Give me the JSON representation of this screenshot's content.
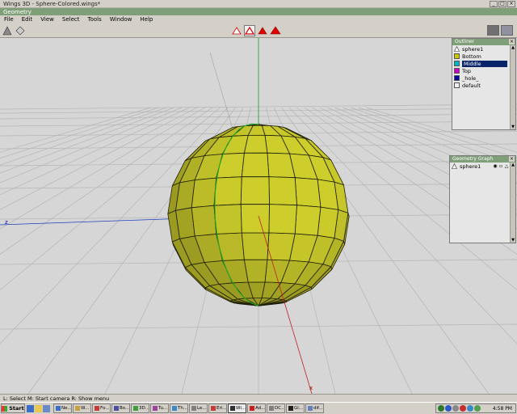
{
  "window": {
    "title": "Wings 3D - Sphere-Colored.wings*"
  },
  "geometry_bar": {
    "label": "Geometry"
  },
  "menu": [
    "File",
    "Edit",
    "View",
    "Select",
    "Tools",
    "Window",
    "Help"
  ],
  "outliner": {
    "title": "Outliner",
    "items": [
      {
        "label": "sphere1",
        "icon": "object-triangle-icon",
        "color": "#ffffff"
      },
      {
        "label": "Bottom",
        "icon": "material-icon",
        "color": "#c8c800"
      },
      {
        "label": "Middle",
        "icon": "material-icon",
        "color": "#00b4c8",
        "selected": true
      },
      {
        "label": "Top",
        "icon": "material-icon",
        "color": "#c800c8"
      },
      {
        "label": "_hole_",
        "icon": "material-icon",
        "color": "#0000a0"
      },
      {
        "label": "default",
        "icon": "material-icon",
        "color": "#f0f0f0"
      }
    ]
  },
  "geometry_graph": {
    "title": "Geometry Graph",
    "items": [
      {
        "label": "sphere1"
      }
    ]
  },
  "viewport": {
    "axis_x_label": "x",
    "axis_z_label": "z",
    "sphere_color": "#cdcd2c",
    "sphere_shade": "#8a8a1e"
  },
  "statusbar": {
    "text": "L: Select   M: Start camera   R: Show menu"
  },
  "taskbar": {
    "start_label": "Start",
    "tasks": [
      {
        "label": "Ne...",
        "color": "#3a6ec8"
      },
      {
        "label": "W...",
        "color": "#c8a040"
      },
      {
        "label": "Fo...",
        "color": "#c83a3a"
      },
      {
        "label": "Bo...",
        "color": "#5050a0"
      },
      {
        "label": "3D...",
        "color": "#40a040"
      },
      {
        "label": "Tu...",
        "color": "#a040a0"
      },
      {
        "label": "Th...",
        "color": "#3a8ac8"
      },
      {
        "label": "Le...",
        "color": "#808080"
      },
      {
        "label": "Eri...",
        "color": "#c83a3a"
      },
      {
        "label": "Wi...",
        "color": "#303030",
        "active": true
      },
      {
        "label": "Ad...",
        "color": "#c82020"
      },
      {
        "label": "DC...",
        "color": "#808080"
      },
      {
        "label": "Gl...",
        "color": "#202020"
      },
      {
        "label": "dif...",
        "color": "#6080c0"
      }
    ],
    "clock": "4:58 PM"
  }
}
